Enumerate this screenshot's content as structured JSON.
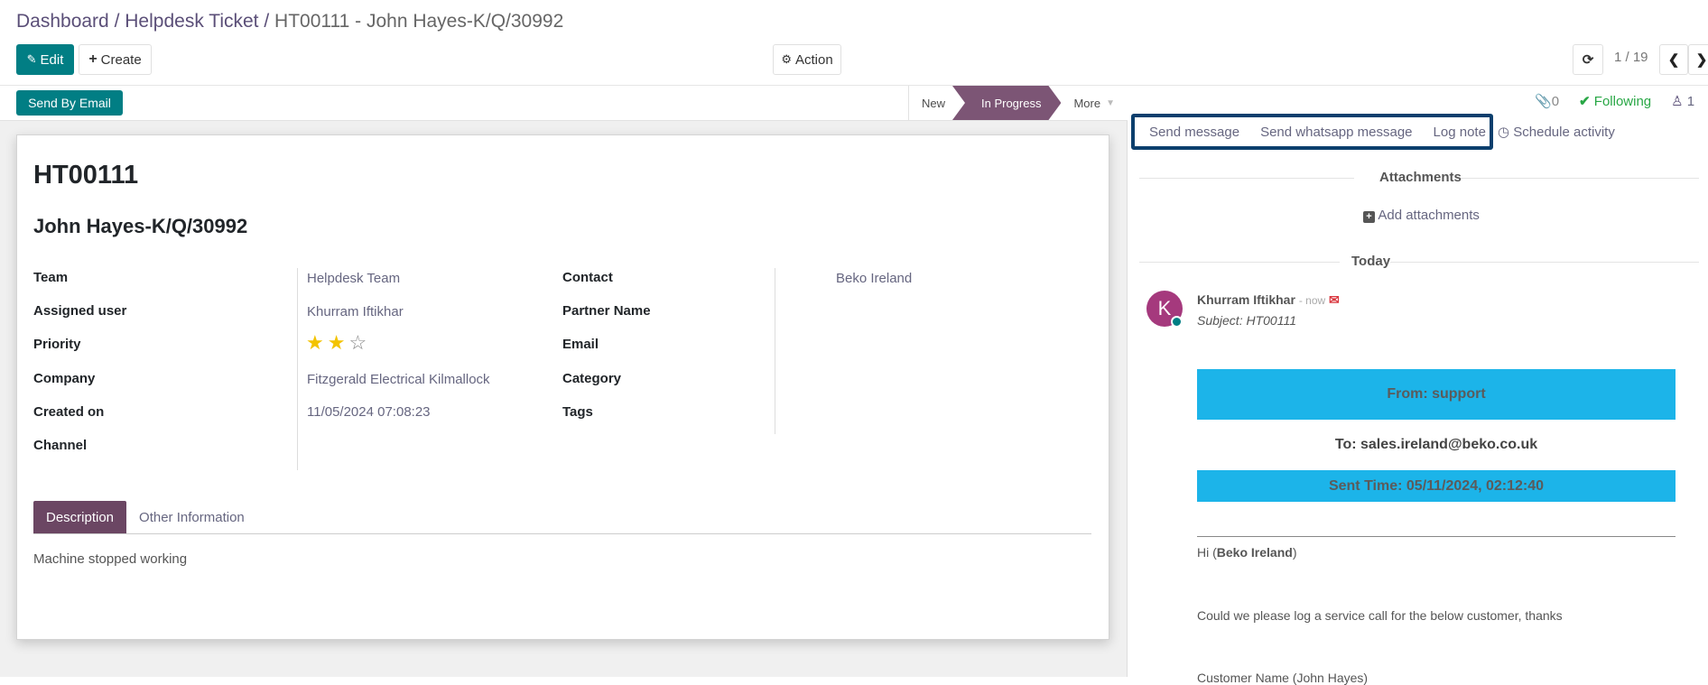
{
  "breadcrumb": {
    "items": [
      "Dashboard",
      "Helpdesk Ticket"
    ],
    "current": "HT00111 - John Hayes-K/Q/30992",
    "separator": "/"
  },
  "toolbar": {
    "edit_label": "Edit",
    "create_label": "Create",
    "action_label": "Action",
    "pager": "1 / 19"
  },
  "statusbar": {
    "send_by_email_label": "Send By Email",
    "stages": [
      {
        "label": "New",
        "active": false
      },
      {
        "label": "In Progress",
        "active": true
      }
    ],
    "more_label": "More"
  },
  "ticket": {
    "reference": "HT00111",
    "name": "John Hayes-K/Q/30992",
    "left_fields": [
      {
        "label": "Team",
        "value": "Helpdesk Team"
      },
      {
        "label": "Assigned user",
        "value": "Khurram Iftikhar"
      },
      {
        "label": "Priority",
        "value": "2 of 3 stars"
      },
      {
        "label": "Company",
        "value": "Fitzgerald Electrical Kilmallock"
      },
      {
        "label": "Created on",
        "value": "11/05/2024 07:08:23"
      },
      {
        "label": "Channel",
        "value": ""
      }
    ],
    "priority_stars": {
      "filled": 2,
      "total": 3
    },
    "right_fields": [
      {
        "label": "Contact",
        "value": "Beko Ireland"
      },
      {
        "label": "Partner Name",
        "value": ""
      },
      {
        "label": "Email",
        "value": ""
      },
      {
        "label": "Category",
        "value": ""
      },
      {
        "label": "Tags",
        "value": ""
      }
    ],
    "tabs": [
      {
        "label": "Description",
        "active": true
      },
      {
        "label": "Other Information",
        "active": false
      }
    ],
    "description": "Machine stopped working"
  },
  "chatter": {
    "attachments_count": "0",
    "following_label": "Following",
    "followers_count": "1",
    "composer_buttons": [
      "Send message",
      "Send whatsapp message",
      "Log note"
    ],
    "schedule_activity_label": "Schedule activity",
    "attachments_title": "Attachments",
    "add_attachments_label": "Add attachments",
    "date_separator": "Today",
    "message": {
      "avatar_initial": "K",
      "author": "Khurram Iftikhar",
      "time": "- now",
      "subject": "Subject: HT00111",
      "from": "From: support",
      "to": "To: sales.ireland@beko.co.uk",
      "sent_time": "Sent Time: 05/11/2024, 02:12:40",
      "greeting_prefix": "Hi (",
      "greeting_name": "Beko Ireland",
      "greeting_suffix": ")",
      "line1": "Could we please log a service call for the below customer, thanks",
      "line2_partial": "Customer Name (John Hayes)"
    }
  },
  "colors": {
    "primary": "#017e84",
    "stage_active": "#7c5575",
    "tab_active": "#6b4663",
    "following": "#28a745",
    "email_band": "#1cb4e9",
    "highlight_box": "#0c3f6d"
  }
}
